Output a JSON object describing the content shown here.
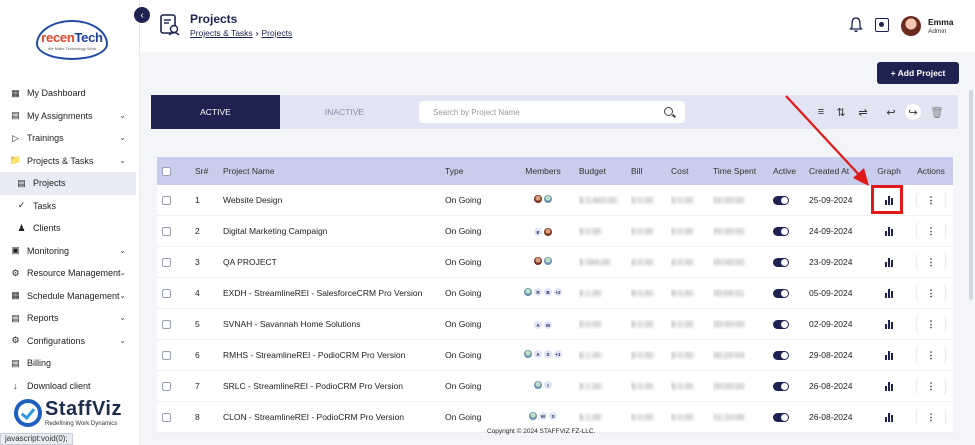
{
  "sidebar": {
    "logo": {
      "brand_prefix": "recen",
      "brand_suffix": "Tech",
      "tagline": "We Make Technology Work"
    },
    "collapse_icon": "chevron-left-icon",
    "items": [
      {
        "label": "My Dashboard",
        "icon": "dashboard-icon",
        "chevron": false
      },
      {
        "label": "My Assignments",
        "icon": "assignments-icon",
        "chevron": true
      },
      {
        "label": "Trainings",
        "icon": "play-icon",
        "chevron": true
      },
      {
        "label": "Projects & Tasks",
        "icon": "folder-icon",
        "chevron": true
      },
      {
        "label": "Projects",
        "icon": "projects-icon",
        "chevron": false,
        "sub": true,
        "active": true
      },
      {
        "label": "Tasks",
        "icon": "check-circle-icon",
        "chevron": false,
        "sub": true
      },
      {
        "label": "Clients",
        "icon": "clients-icon",
        "chevron": false,
        "sub": true
      },
      {
        "label": "Monitoring",
        "icon": "monitor-icon",
        "chevron": true
      },
      {
        "label": "Resource Management",
        "icon": "resource-icon",
        "chevron": true
      },
      {
        "label": "Schedule Management",
        "icon": "calendar-icon",
        "chevron": true
      },
      {
        "label": "Reports",
        "icon": "reports-icon",
        "chevron": true
      },
      {
        "label": "Configurations",
        "icon": "settings-icon",
        "chevron": true
      },
      {
        "label": "Billing",
        "icon": "billing-icon",
        "chevron": false
      },
      {
        "label": "Download client",
        "icon": "download-icon",
        "chevron": false
      }
    ],
    "footer_brand": {
      "name": "StaffViz",
      "tagline": "Redefining Work Dynamics"
    }
  },
  "statusbar": {
    "text": "javascript:void(0);"
  },
  "header": {
    "title": "Projects",
    "breadcrumb": [
      "Projects & Tasks",
      "Projects"
    ],
    "user": {
      "name": "Emma",
      "role": "Admin"
    }
  },
  "actions": {
    "add_project": "+ Add Project"
  },
  "toolbar": {
    "tab_active": "ACTIVE",
    "tab_inactive": "INACTIVE",
    "search_placeholder": "Search by Project Name"
  },
  "table": {
    "headers": [
      "Sr#",
      "Project Name",
      "Type",
      "Members",
      "Budget",
      "Bill",
      "Cost",
      "Time Spent",
      "Active",
      "Created At",
      "Graph",
      "Actions"
    ],
    "rows": [
      {
        "sr": "1",
        "name": "Website Design",
        "type": "On Going",
        "members": [
          "ph",
          "ph2"
        ],
        "budget": "$ 3,443.00",
        "bill": "$ 0.00",
        "cost": "$ 0.00",
        "time": "00:00:00",
        "created": "25-09-2024"
      },
      {
        "sr": "2",
        "name": "Digital Marketing Campaign",
        "type": "On Going",
        "members": [
          "E",
          "ph"
        ],
        "budget": "$ 0.00",
        "bill": "$ 0.00",
        "cost": "$ 0.00",
        "time": "00:00:00",
        "created": "24-09-2024"
      },
      {
        "sr": "3",
        "name": "QA PROJECT",
        "type": "On Going",
        "members": [
          "ph",
          "ph2"
        ],
        "budget": "$ 344.00",
        "bill": "$ 0.00",
        "cost": "$ 0.00",
        "time": "00:00:00",
        "created": "23-09-2024"
      },
      {
        "sr": "4",
        "name": "EXDH - StreamlineREI - SalesforceCRM Pro Version",
        "type": "On Going",
        "members": [
          "ph2",
          "R",
          "B",
          "+2"
        ],
        "budget": "$ 1.00",
        "bill": "$ 0.00",
        "cost": "$ 0.00",
        "time": "00:04:01",
        "created": "05-09-2024"
      },
      {
        "sr": "5",
        "name": "SVNAH - Savannah Home Solutions",
        "type": "On Going",
        "members": [
          "A",
          "M"
        ],
        "budget": "$ 0.00",
        "bill": "$ 0.00",
        "cost": "$ 0.00",
        "time": "00:00:00",
        "created": "02-09-2024"
      },
      {
        "sr": "6",
        "name": "RMHS - StreamlineREI - PodioCRM Pro Version",
        "type": "On Going",
        "members": [
          "ph2",
          "A",
          "S",
          "+1"
        ],
        "budget": "$ 1.00",
        "bill": "$ 0.00",
        "cost": "$ 0.00",
        "time": "00:20:54",
        "created": "29-08-2024"
      },
      {
        "sr": "7",
        "name": "SRLC - StreamlineREI - PodioCRM Pro Version",
        "type": "On Going",
        "members": [
          "ph2",
          "I"
        ],
        "budget": "$ 1.00",
        "bill": "$ 0.00",
        "cost": "$ 0.00",
        "time": "00:00:00",
        "created": "26-08-2024"
      },
      {
        "sr": "8",
        "name": "CLON - StreamlineREI - PodioCRM Pro Version",
        "type": "On Going",
        "members": [
          "ph2",
          "M",
          "S"
        ],
        "budget": "$ 1.00",
        "bill": "$ 0.00",
        "cost": "$ 0.00",
        "time": "01:10:06",
        "created": "26-08-2024"
      }
    ]
  },
  "footer": {
    "copyright": "Copyright © 2024 STAFFVIZ FZ-LLC."
  },
  "colors": {
    "primary": "#1d2250",
    "highlight": "#e01818",
    "header_row": "#c9cdec"
  }
}
